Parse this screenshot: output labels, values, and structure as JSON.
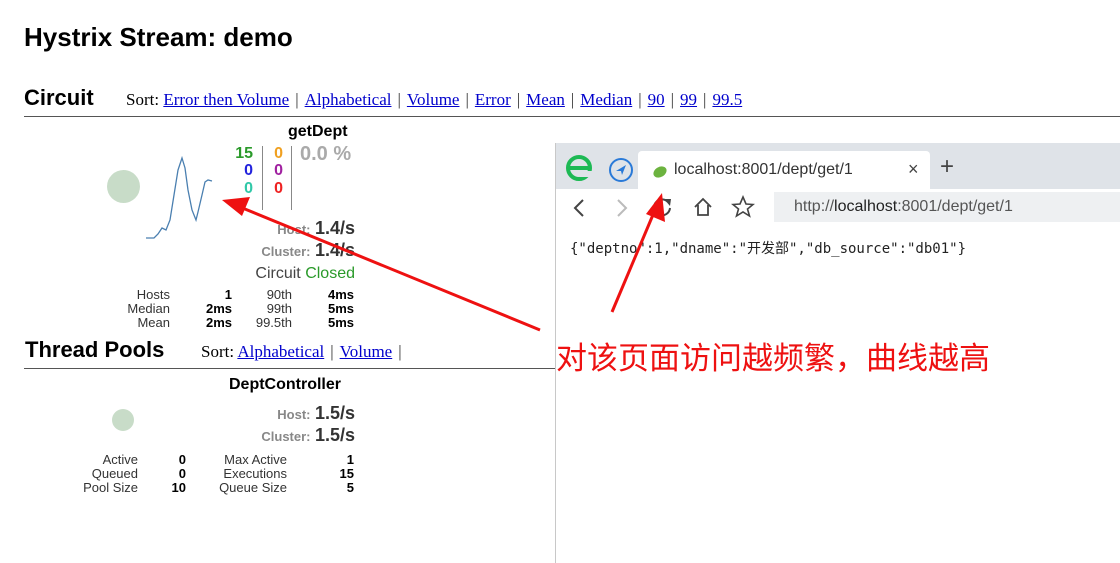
{
  "page_title": "Hystrix Stream: demo",
  "circuit": {
    "section_title": "Circuit",
    "sort_label": "Sort:",
    "sort_links": [
      "Error then Volume",
      "Alphabetical",
      "Volume",
      "Error",
      "Mean",
      "Median",
      "90",
      "99",
      "99.5"
    ],
    "name": "getDept",
    "counts_green": "15",
    "counts_blue": "0",
    "counts_teal": "0",
    "counts_orange": "0",
    "counts_purple": "0",
    "counts_red": "0",
    "error_pct": "0.0 %",
    "host_label": "Host:",
    "host_rate": "1.4/s",
    "cluster_label": "Cluster:",
    "cluster_rate": "1.4/s",
    "circuit_label": "Circuit",
    "circuit_status": "Closed",
    "stats": [
      {
        "label": "Hosts",
        "value": "1",
        "p_label": "90th",
        "p_value": "4ms"
      },
      {
        "label": "Median",
        "value": "2ms",
        "p_label": "99th",
        "p_value": "5ms"
      },
      {
        "label": "Mean",
        "value": "2ms",
        "p_label": "99.5th",
        "p_value": "5ms"
      }
    ]
  },
  "thread_pools": {
    "section_title": "Thread Pools",
    "sort_label": "Sort:",
    "sort_links": [
      "Alphabetical",
      "Volume"
    ],
    "name": "DeptController",
    "host_label": "Host:",
    "host_rate": "1.5/s",
    "cluster_label": "Cluster:",
    "cluster_rate": "1.5/s",
    "stats": [
      {
        "label": "Active",
        "value": "0",
        "label2": "Max Active",
        "value2": "1"
      },
      {
        "label": "Queued",
        "value": "0",
        "label2": "Executions",
        "value2": "15"
      },
      {
        "label": "Pool Size",
        "value": "10",
        "label2": "Queue Size",
        "value2": "5"
      }
    ]
  },
  "browser": {
    "tab_title": "localhost:8001/dept/get/1",
    "close_glyph": "×",
    "new_tab_glyph": "+",
    "url_prefix": "http://",
    "url_host": "localhost",
    "url_rest": ":8001/dept/get/1",
    "body_text": "{\"deptno\":1,\"dname\":\"开发部\",\"db_source\":\"db01\"}"
  },
  "annotation": "对该页面访问越频繁，曲线越高",
  "colors": {
    "green": "#2a9a2a",
    "blue": "#2222dd",
    "teal": "#30c8a8",
    "orange": "#f0a020",
    "purple": "#a020a0",
    "red": "#ee2222",
    "link": "#0000cc",
    "annotation_red": "#ee1111",
    "circle": "#c8dcc8",
    "sparkline": "#4a7fb0"
  },
  "icons": [
    "edge-logo-icon",
    "navigation-icon",
    "leaf-favicon-icon",
    "back-icon",
    "forward-icon",
    "refresh-icon",
    "home-icon",
    "star-icon",
    "close-icon",
    "plus-icon"
  ]
}
